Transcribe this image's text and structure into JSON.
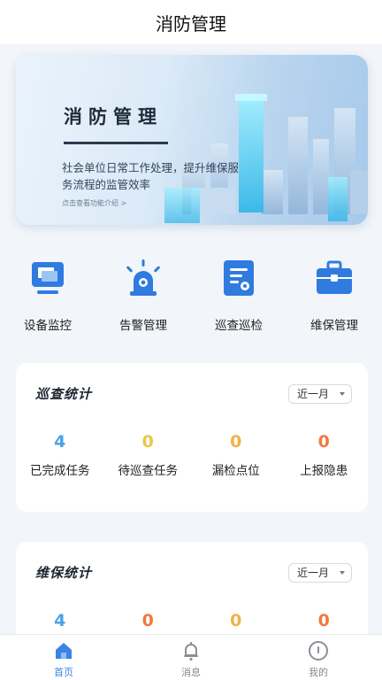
{
  "header": {
    "title": "消防管理"
  },
  "banner": {
    "title": "消防管理",
    "desc": "社会单位日常工作处理，提升维保服务流程的监管效率",
    "link": "点击查看功能介绍 >"
  },
  "quick_actions": [
    {
      "label": "设备监控",
      "icon": "monitor-icon"
    },
    {
      "label": "告警管理",
      "icon": "alarm-icon"
    },
    {
      "label": "巡查巡检",
      "icon": "inspection-icon"
    },
    {
      "label": "维保管理",
      "icon": "toolbox-icon"
    }
  ],
  "patrol_stats": {
    "title": "巡查统计",
    "period": "近一月",
    "items": [
      {
        "value": "4",
        "label": "已完成任务",
        "color": "#4aa3e8"
      },
      {
        "value": "0",
        "label": "待巡查任务",
        "color": "#e8c64a"
      },
      {
        "value": "0",
        "label": "漏检点位",
        "color": "#f0b24a"
      },
      {
        "value": "0",
        "label": "上报隐患",
        "color": "#ee7a3f"
      }
    ]
  },
  "maintenance_stats": {
    "title": "维保统计",
    "period": "近一月",
    "items": [
      {
        "value": "4",
        "color": "#4aa3e8"
      },
      {
        "value": "0",
        "color": "#ee7a3f"
      },
      {
        "value": "0",
        "color": "#f0b24a"
      },
      {
        "value": "0",
        "color": "#ee7a3f"
      }
    ]
  },
  "tabbar": [
    {
      "label": "首页",
      "icon": "home-icon",
      "active": true
    },
    {
      "label": "消息",
      "icon": "bell-icon",
      "active": false
    },
    {
      "label": "我的",
      "icon": "profile-icon",
      "active": false
    }
  ],
  "colors": {
    "accent": "#3b83e6",
    "icon_blue": "#2f7be0"
  }
}
